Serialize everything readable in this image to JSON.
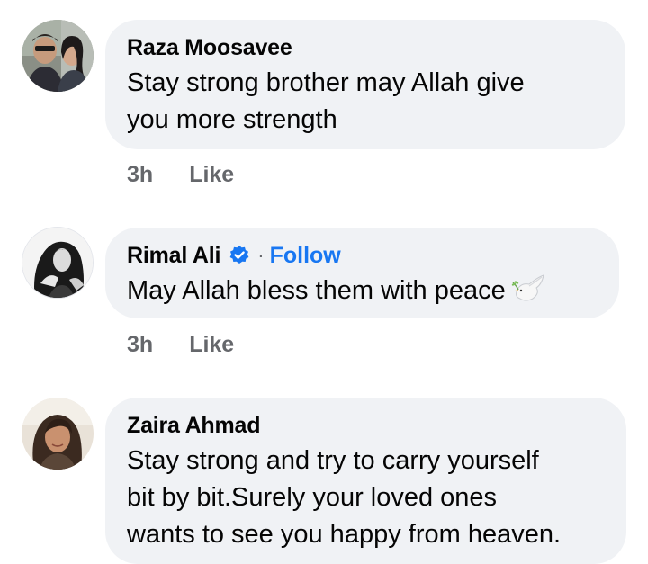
{
  "comments": [
    {
      "author": "Raza Moosavee",
      "verified": false,
      "text_lines": [
        "Stay strong brother may Allah give",
        "you more strength"
      ],
      "time": "3h",
      "like_label": "Like",
      "avatar_icon": "avatar-couple-photo"
    },
    {
      "author": "Rimal Ali",
      "verified": true,
      "follow_label": "Follow",
      "text_lines": [
        "May Allah bless them with peace"
      ],
      "emoji": "dove-with-olive-branch-emoji",
      "time": "3h",
      "like_label": "Like",
      "avatar_icon": "avatar-monochrome-portrait"
    },
    {
      "author": "Zaira Ahmad",
      "verified": false,
      "text_lines": [
        "Stay strong and try to carry yourself",
        "bit by bit.Surely your loved ones",
        "wants to see you happy from heaven."
      ],
      "time": "",
      "like_label": "",
      "avatar_icon": "avatar-woman-photo"
    }
  ],
  "separator": "·",
  "colors": {
    "bubble_bg": "#f0f2f5",
    "follow_blue": "#1877f2",
    "meta_gray": "#65676b",
    "verified_blue": "#1877f2"
  }
}
